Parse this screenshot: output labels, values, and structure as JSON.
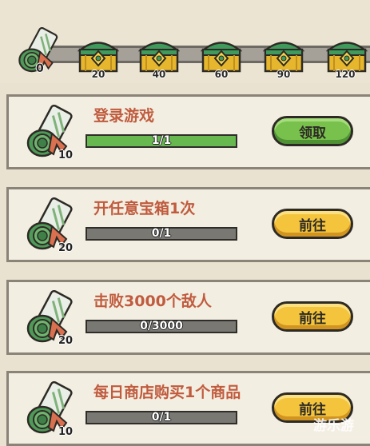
{
  "progress": {
    "current_points": "0",
    "milestones": [
      "20",
      "40",
      "60",
      "90",
      "120"
    ]
  },
  "tasks": [
    {
      "title": "登录游戏",
      "reward": "10",
      "progress_text": "1/1",
      "progress_fraction": 1.0,
      "button": "领取",
      "button_style": "claim"
    },
    {
      "title": "开任意宝箱1次",
      "reward": "20",
      "progress_text": "0/1",
      "progress_fraction": 0.0,
      "button": "前往",
      "button_style": "go"
    },
    {
      "title": "击败3000个敌人",
      "reward": "20",
      "progress_text": "0/3000",
      "progress_fraction": 0.0,
      "button": "前往",
      "button_style": "go"
    },
    {
      "title": "每日商店购买1个商品",
      "reward": "10",
      "progress_text": "0/1",
      "progress_fraction": 0.0,
      "button": "前往",
      "button_style": "go"
    }
  ],
  "watermark": "游乐游",
  "colors": {
    "claim_button": "#78c14c",
    "go_button": "#f4c43c",
    "progress_fill": "#67b84e",
    "title_text": "#c05b3e"
  }
}
